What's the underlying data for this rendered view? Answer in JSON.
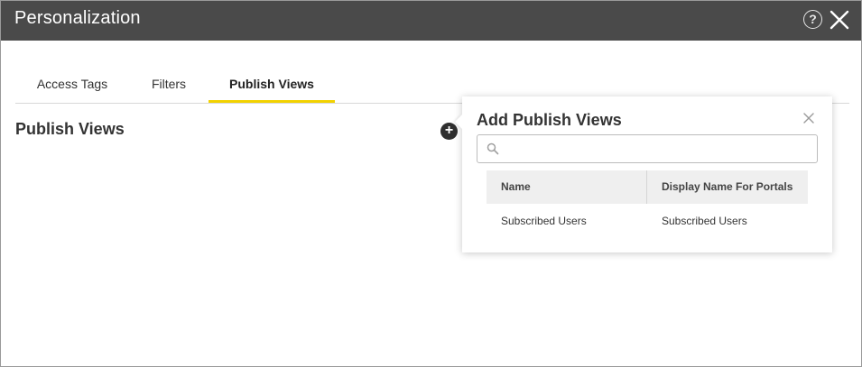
{
  "window": {
    "title": "Personalization",
    "help_symbol": "?"
  },
  "tabs": [
    {
      "label": "Access Tags",
      "active": false
    },
    {
      "label": "Filters",
      "active": false
    },
    {
      "label": "Publish Views",
      "active": true
    }
  ],
  "section": {
    "title": "Publish Views",
    "add_symbol": "+"
  },
  "popover": {
    "title": "Add Publish Views",
    "search": {
      "value": "",
      "placeholder": ""
    },
    "table": {
      "columns": [
        "Name",
        "Display Name For Portals"
      ],
      "rows": [
        [
          "Subscribed Users",
          "Subscribed Users"
        ]
      ]
    }
  },
  "colors": {
    "titlebar": "#4a4a4a",
    "active_tab_underline": "#f2d200"
  },
  "icons": {
    "help": "help-circle-icon",
    "close": "close-icon",
    "add": "plus-circle-icon",
    "search": "search-icon"
  }
}
